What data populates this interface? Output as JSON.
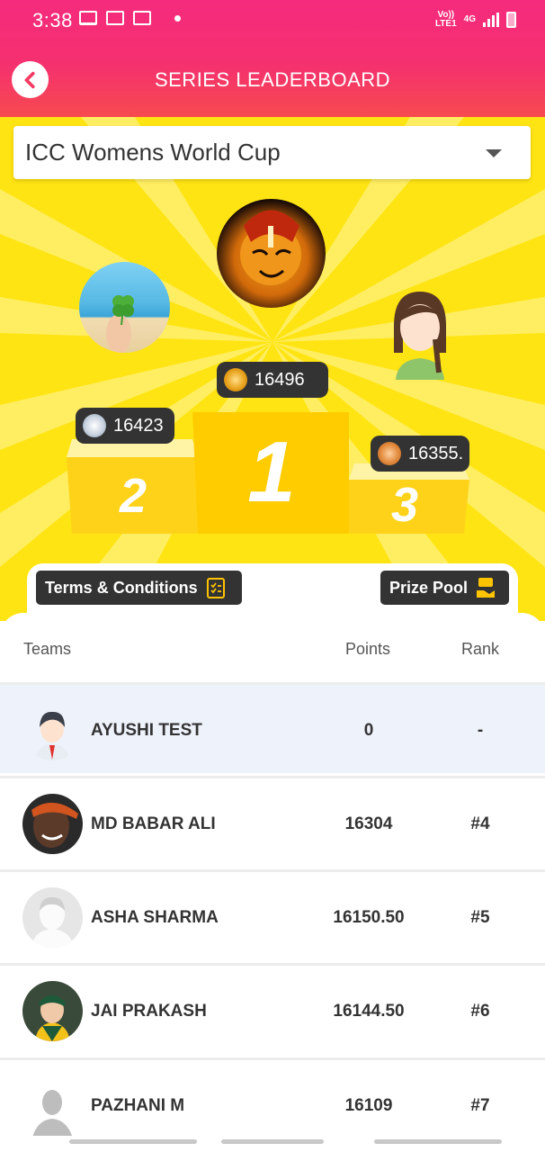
{
  "status_bar": {
    "time": "3:38",
    "network_top": "Vo))",
    "network_bottom": "LTE1",
    "network_type": "4G",
    "icons": [
      "laptop-icon",
      "voicemail-icon",
      "image-icon",
      "dot-icon",
      "signal-icon",
      "battery-icon"
    ]
  },
  "header": {
    "title": "SERIES LEADERBOARD",
    "back_icon": "chevron-left-icon"
  },
  "series_select": {
    "selected": "ICC Womens World Cup"
  },
  "podium": {
    "first": {
      "rank": "1",
      "points": "16496",
      "medal": "gold"
    },
    "second": {
      "rank": "2",
      "points": "16423",
      "medal": "silver"
    },
    "third": {
      "rank": "3",
      "points": "16355.",
      "medal": "bronze"
    }
  },
  "links": {
    "terms_label": "Terms & Conditions",
    "prize_label": "Prize Pool"
  },
  "table": {
    "headers": {
      "teams": "Teams",
      "points": "Points",
      "rank": "Rank"
    },
    "rows": [
      {
        "name": "AYUSHI TEST",
        "points": "0",
        "rank": "-",
        "highlight": true
      },
      {
        "name": "MD BABAR ALI",
        "points": "16304",
        "rank": "#4"
      },
      {
        "name": "ASHA SHARMA",
        "points": "16150.50",
        "rank": "#5"
      },
      {
        "name": "JAI PRAKASH",
        "points": "16144.50",
        "rank": "#6"
      },
      {
        "name": "PAZHANI M",
        "points": "16109",
        "rank": "#7"
      }
    ]
  },
  "colors": {
    "header_top": "#f52b7d",
    "header_bottom": "#f74a4f",
    "podium_background": "#ffe413",
    "dark_pill": "#333333"
  }
}
